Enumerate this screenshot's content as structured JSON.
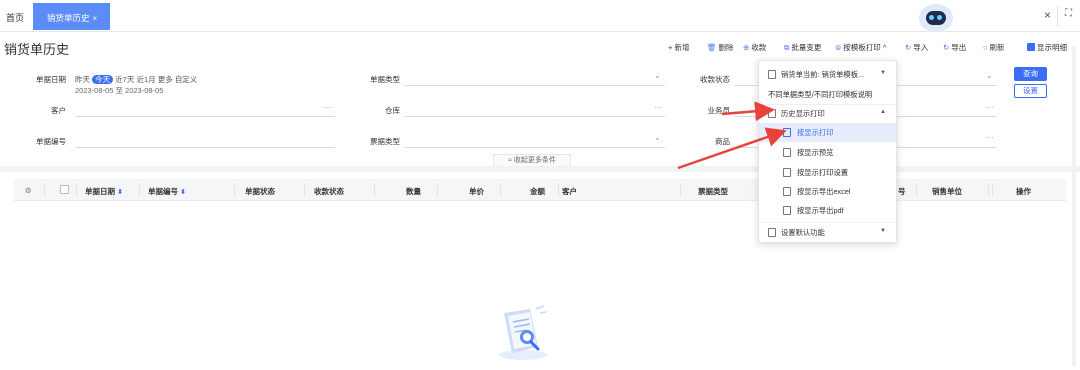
{
  "tabs": {
    "home": "首页",
    "active": "销货单历史",
    "active_close": "×"
  },
  "window": {
    "close": "×",
    "fullscreen": "⛶"
  },
  "page": {
    "title": "销货单历史"
  },
  "toolbar": {
    "add": "+ 新增",
    "delete": "删除",
    "collect": "收款",
    "batch_change": "批量变更",
    "print_template": "按模板打印",
    "print_template_caret": "^",
    "import": "导入",
    "export": "导出",
    "refresh": "刷新",
    "show_detail": "显示明细"
  },
  "filters": {
    "date_label": "单据日期",
    "date_quick": [
      "昨天",
      "今天",
      "近7天",
      "近1月",
      "更多",
      "自定义"
    ],
    "date_selected_index": 1,
    "date_range": "2023-08-05 至 2023-08-05",
    "doc_type_label": "单据类型",
    "collect_status_label": "收款状态",
    "customer_label": "客户",
    "warehouse_label": "仓库",
    "salesperson_label": "业务员",
    "doc_no_label": "单据编号",
    "invoice_type_label": "票据类型",
    "product_label": "商品",
    "dropdown_caret": "⌄",
    "more_dots": "···",
    "query_button": "查询",
    "settings_button": "设置",
    "collapse_label": "≈ 收起更多条件"
  },
  "table": {
    "gear": "⚙",
    "columns": [
      "单据日期",
      "单据编号",
      "单据状态",
      "收款状态",
      "数量",
      "单价",
      "金额",
      "客户",
      "票据类型",
      "",
      "销售单位",
      "操作"
    ],
    "partial_col": "号",
    "sort_icon": "⬍"
  },
  "menu": {
    "header": "销货单当前: 销货单模板...",
    "note": "不同单据类型/不同打印模板说明",
    "history_group": "历史显示打印",
    "items": [
      "按显示打印",
      "按显示预览",
      "按显示打印设置",
      "按显示导出excel",
      "按显示导出pdf"
    ],
    "highlight_index": 0,
    "default_func": "设置默认功能"
  },
  "colors": {
    "accent": "#3b6ef5",
    "tab_active": "#5b8cf7",
    "arrow": "#e8433a"
  }
}
